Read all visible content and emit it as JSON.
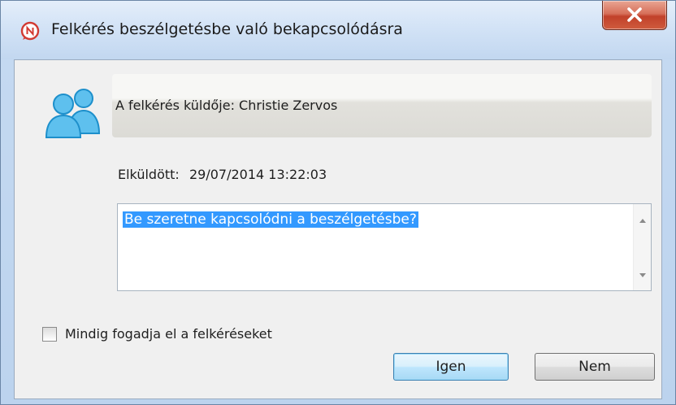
{
  "window": {
    "title": "Felkérés beszélgetésbe való bekapcsolódásra"
  },
  "request": {
    "sender_text": "A felkérés küldője: Christie Zervos",
    "sent_label": "Elküldött:",
    "sent_value": "29/07/2014 13:22:03",
    "message": "Be szeretne kapcsolódni a beszélgetésbe?"
  },
  "options": {
    "always_accept_label": "Mindig fogadja el a felkéréseket",
    "always_accept_checked": false
  },
  "buttons": {
    "yes_label": "Igen",
    "no_label": "Nem"
  },
  "colors": {
    "selection": "#3399ff",
    "close_button": "#c1412a",
    "avatar": "#2ea3dc"
  },
  "icons": {
    "app": "chat-bubble-icon",
    "close": "close-icon",
    "avatar": "people-icon"
  }
}
